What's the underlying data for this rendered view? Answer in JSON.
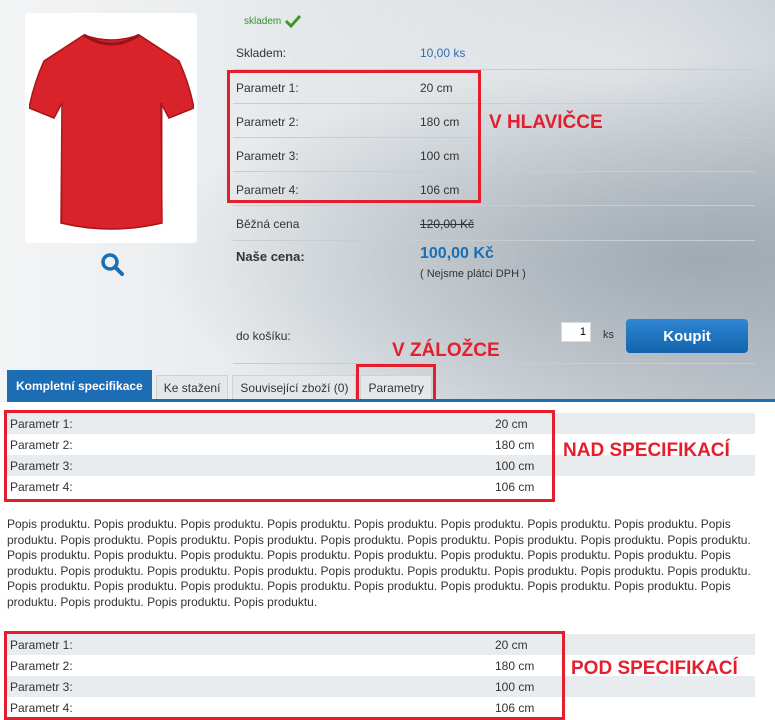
{
  "stock_status": "skladem",
  "info": {
    "stock_label": "Skladem:",
    "stock_value": "10,00 ks",
    "params": [
      {
        "label": "Parametr 1:",
        "value": "20 cm"
      },
      {
        "label": "Parametr 2:",
        "value": "180 cm"
      },
      {
        "label": "Parametr 3:",
        "value": "100 cm"
      },
      {
        "label": "Parametr 4:",
        "value": "106 cm"
      }
    ],
    "regular_price_label": "Běžná cena",
    "regular_price_value": "120,00 Kč",
    "our_price_label": "Naše cena:",
    "our_price_value": "100,00 Kč",
    "vat_note": "( Nejsme plátci DPH )",
    "cart_label": "do košíku:",
    "quantity": "1",
    "quantity_unit": "ks",
    "buy_label": "Koupit"
  },
  "annotations": {
    "header": "V HLAVIČCE",
    "tab": "V ZÁLOŽCE",
    "above": "NAD SPECIFIKACÍ",
    "below": "POD SPECIFIKACÍ"
  },
  "tabs": [
    {
      "label": "Kompletní specifikace",
      "active": true
    },
    {
      "label": "Ke stažení"
    },
    {
      "label": "Související zboží (0)"
    },
    {
      "label": "Parametry"
    }
  ],
  "spec_top": [
    {
      "label": "Parametr 1:",
      "value": "20 cm"
    },
    {
      "label": "Parametr 2:",
      "value": "180 cm"
    },
    {
      "label": "Parametr 3:",
      "value": "100 cm"
    },
    {
      "label": "Parametr 4:",
      "value": "106 cm"
    }
  ],
  "description": "Popis produktu. Popis produktu. Popis produktu. Popis produktu. Popis produktu. Popis produktu. Popis produktu. Popis produktu. Popis produktu. Popis produktu. Popis produktu. Popis produktu. Popis produktu. Popis produktu. Popis produktu. Popis produktu. Popis produktu. Popis produktu. Popis produktu. Popis produktu. Popis produktu. Popis produktu. Popis produktu. Popis produktu. Popis produktu. Popis produktu. Popis produktu. Popis produktu. Popis produktu. Popis produktu. Popis produktu. Popis produktu. Popis produktu. Popis produktu. Popis produktu. Popis produktu. Popis produktu. Popis produktu. Popis produktu. Popis produktu. Popis produktu. Popis produktu. Popis produktu. Popis produktu. Popis produktu. Popis produktu.",
  "spec_bottom": [
    {
      "label": "Parametr 1:",
      "value": "20 cm"
    },
    {
      "label": "Parametr 2:",
      "value": "180 cm"
    },
    {
      "label": "Parametr 3:",
      "value": "100 cm"
    },
    {
      "label": "Parametr 4:",
      "value": "106 cm"
    }
  ],
  "colors": {
    "accent": "#1d6db5",
    "annotation": "#e41f2d",
    "stock_green": "#3b8f2f",
    "shirt_red": "#d8232a"
  },
  "icons": {
    "zoom": "magnifier-icon",
    "stock": "checkmark-icon"
  }
}
